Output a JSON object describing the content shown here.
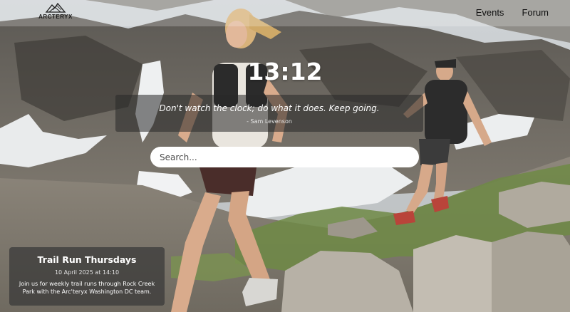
{
  "brand": {
    "name": "ARCTERYX"
  },
  "nav": {
    "items": [
      {
        "label": "Events"
      },
      {
        "label": "Forum"
      }
    ]
  },
  "clock": {
    "time": "13:12"
  },
  "quote": {
    "text": "Don't watch the clock; do what it does. Keep going.",
    "author": "- Sam Levenson"
  },
  "search": {
    "placeholder": "Search..."
  },
  "event": {
    "title": "Trail Run Thursdays",
    "date": "10 April 2025 at 14:10",
    "description": "Join us for weekly trail runs through Rock Creek Park with the Arc'teryx Washington DC team."
  },
  "colors": {
    "topbar": "#ffffff",
    "text_dark": "#111111",
    "overlay": "#282828"
  }
}
